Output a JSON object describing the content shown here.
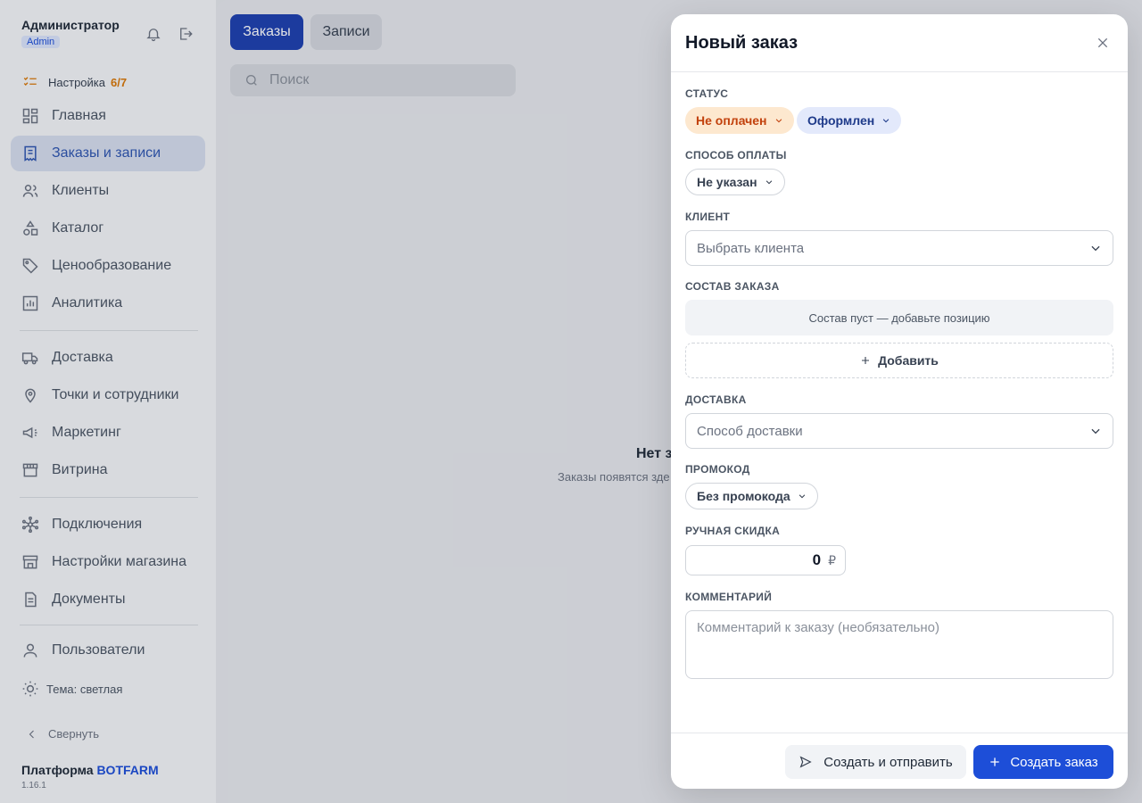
{
  "user": {
    "name": "Администратор",
    "role": "Admin"
  },
  "setup": {
    "label": "Настройка",
    "count": "6/7"
  },
  "nav": [
    {
      "label": "Главная",
      "icon": "dashboard-icon"
    },
    {
      "label": "Заказы и записи",
      "icon": "orders-icon",
      "active": true
    },
    {
      "label": "Клиенты",
      "icon": "users-icon"
    },
    {
      "label": "Каталог",
      "icon": "catalog-icon"
    },
    {
      "label": "Ценообразование",
      "icon": "tag-icon"
    },
    {
      "label": "Аналитика",
      "icon": "chart-icon"
    },
    {
      "label": "Доставка",
      "icon": "truck-icon"
    },
    {
      "label": "Точки и сотрудники",
      "icon": "pin-icon"
    },
    {
      "label": "Маркетинг",
      "icon": "megaphone-icon"
    },
    {
      "label": "Витрина",
      "icon": "storefront-icon"
    },
    {
      "label": "Подключения",
      "icon": "integrations-icon"
    },
    {
      "label": "Настройки магазина",
      "icon": "store-settings-icon"
    },
    {
      "label": "Документы",
      "icon": "document-icon"
    },
    {
      "label": "Пользователи",
      "icon": "user-icon"
    }
  ],
  "theme_label": "Тема: светлая",
  "collapse_label": "Свернуть",
  "brand": {
    "prefix": "Платформа",
    "name": "BOTFARM",
    "version": "1.16.1"
  },
  "main": {
    "tabs": [
      {
        "label": "Заказы",
        "active": true
      },
      {
        "label": "Записи",
        "active": false
      }
    ],
    "search_placeholder": "Поиск",
    "empty_title": "Нет з",
    "empty_subtitle": "Заказы появятся зде"
  },
  "modal": {
    "title": "Новый заказ",
    "status_label": "СТАТУС",
    "payment_status": "Не оплачен",
    "order_status": "Оформлен",
    "payment_method_label": "СПОСОБ ОПЛАТЫ",
    "payment_method": "Не указан",
    "client_label": "КЛИЕНТ",
    "client_placeholder": "Выбрать клиента",
    "items_label": "СОСТАВ ЗАКАЗА",
    "items_empty": "Состав пуст — добавьте позицию",
    "add_label": "Добавить",
    "delivery_label": "ДОСТАВКА",
    "delivery_placeholder": "Способ доставки",
    "promo_label": "ПРОМОКОД",
    "promo_value": "Без промокода",
    "discount_label": "РУЧНАЯ СКИДКА",
    "discount_value": "0",
    "discount_currency": "₽",
    "comment_label": "КОММЕНТАРИЙ",
    "comment_placeholder": "Комментарий к заказу (необязательно)",
    "create_send_label": "Создать и отправить",
    "create_label": "Создать заказ"
  },
  "colors": {
    "accent": "#1d4ed8",
    "warning": "#c2410c",
    "badge_orange_bg": "#fde8cf"
  }
}
